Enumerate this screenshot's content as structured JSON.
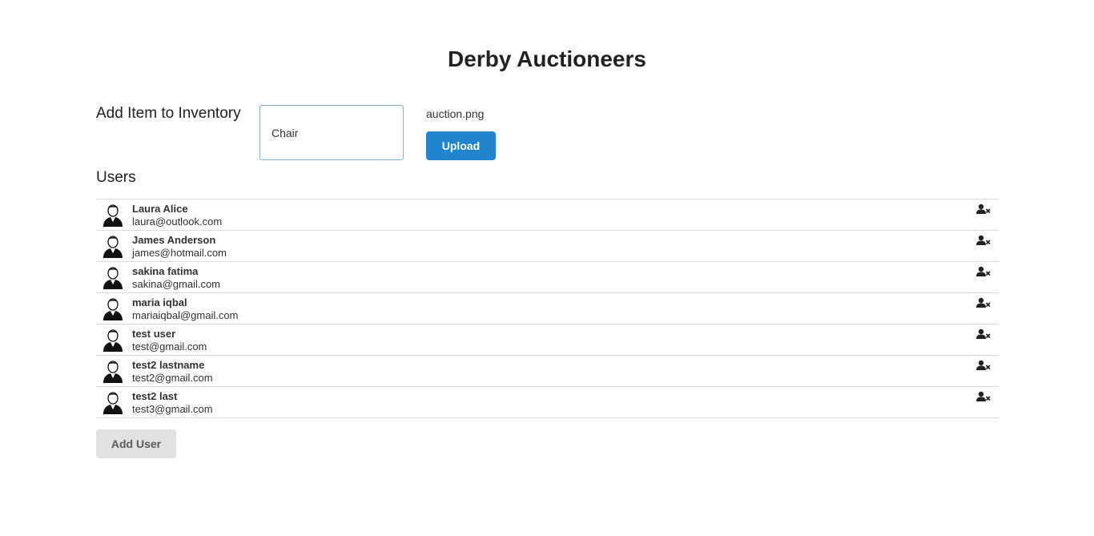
{
  "header": {
    "title": "Derby Auctioneers"
  },
  "inventory": {
    "heading": "Add Item to Inventory",
    "item_value": "Chair",
    "file_name": "auction.png",
    "upload_label": "Upload"
  },
  "users": {
    "heading": "Users",
    "items": [
      {
        "name": "Laura Alice",
        "email": "laura@outlook.com"
      },
      {
        "name": "James Anderson",
        "email": "james@hotmail.com"
      },
      {
        "name": "sakina fatima",
        "email": "sakina@gmail.com"
      },
      {
        "name": "maria iqbal",
        "email": "mariaiqbal@gmail.com"
      },
      {
        "name": "test user",
        "email": "test@gmail.com"
      },
      {
        "name": "test2 lastname",
        "email": "test2@gmail.com"
      },
      {
        "name": "test2 last",
        "email": "test3@gmail.com"
      }
    ],
    "add_label": "Add User"
  },
  "icons": {
    "avatar": "user-avatar-icon",
    "remove": "remove-user-icon"
  },
  "colors": {
    "primary": "#2185d0",
    "secondary_button": "#e0e1e2",
    "divider": "#dcdcdc",
    "input_border": "#7fb3cf"
  }
}
